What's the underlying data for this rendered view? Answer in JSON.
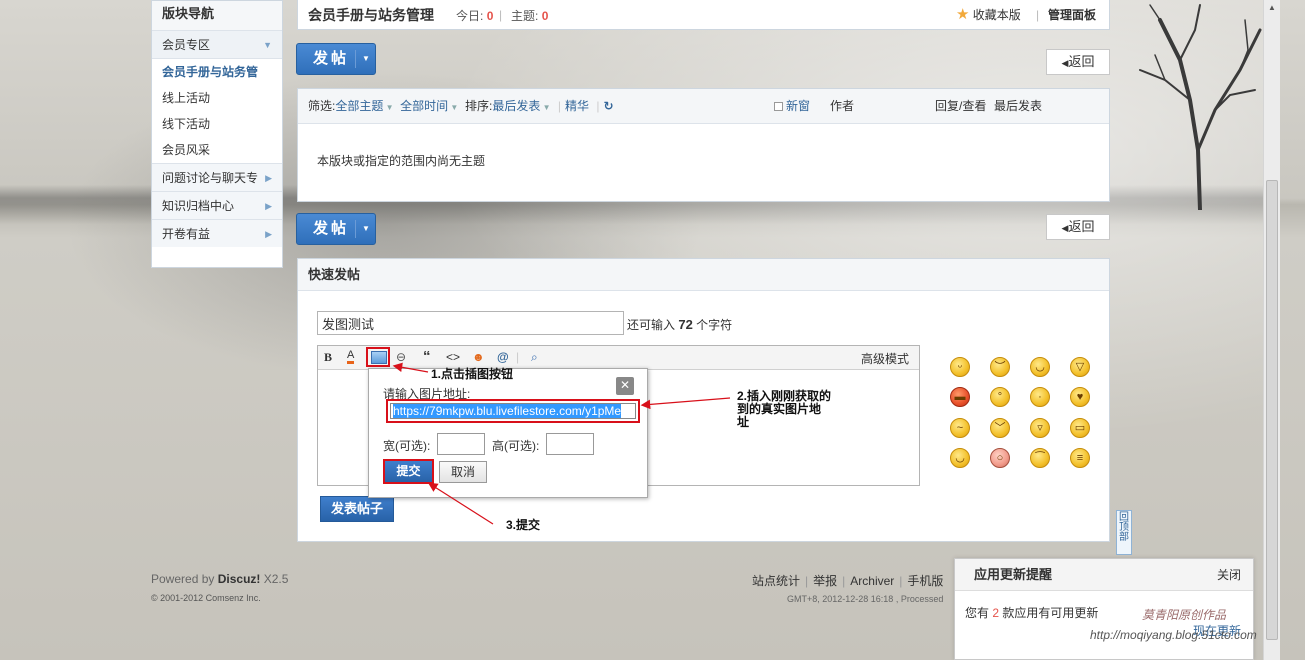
{
  "sidebar": {
    "title": "版块导航",
    "group1": "会员专区",
    "items": [
      "会员手册与站务管",
      "线上活动",
      "线下活动",
      "会员风采"
    ],
    "subgroups": [
      "问题讨论与聊天专",
      "知识归档中心",
      "开卷有益"
    ]
  },
  "header": {
    "forum_title": "会员手册与站务管理",
    "today_label": "今日:",
    "today_count": "0",
    "topics_label": "主题:",
    "topics_count": "0",
    "favorite_label": "收藏本版",
    "admin_label": "管理面板"
  },
  "actions": {
    "post_label": "发帖",
    "back_label": "返回"
  },
  "thread_list": {
    "filter_label": "筛选:",
    "all_topics": "全部主题",
    "all_time": "全部时间",
    "sort_label": "排序:",
    "sort_value": "最后发表",
    "digest_label": "精华",
    "new_window_label": "新窗",
    "author_col": "作者",
    "reply_view_col": "回复/查看",
    "last_post_col": "最后发表",
    "empty_message": "本版块或指定的范围内尚无主题"
  },
  "quick_post": {
    "title": "快速发帖",
    "subject_value": "发图测试",
    "remaining_prefix": "还可输入",
    "remaining_count": "72",
    "remaining_suffix": "个字符",
    "advanced_mode": "高级模式",
    "submit_label": "发表帖子"
  },
  "image_dialog": {
    "prompt": "请输入图片地址:",
    "url_value": "https://79mkpw.blu.livefilestore.com/y1pMe",
    "width_label": "宽(可选):",
    "height_label": "高(可选):",
    "submit_label": "提交",
    "cancel_label": "取消"
  },
  "annotations": {
    "step1": "1.点击插图按钮",
    "step2_line1": "2.插入刚刚获取的",
    "step2_line2": "到的真实图片地",
    "step2_line3": "址",
    "step3": "3.提交"
  },
  "footer": {
    "powered_by": "Powered by",
    "brand": "Discuz!",
    "version": "X2.5",
    "copyright": "© 2001-2012 Comsenz Inc.",
    "links": [
      "站点统计",
      "举报",
      "Archiver",
      "手机版"
    ],
    "gmt": "GMT+8, 2012-12-28 16:18 , Processed"
  },
  "back_to_top": "回顶部",
  "notice": {
    "title": "应用更新提醒",
    "close_label": "关闭",
    "message_prefix": "您有",
    "count": "2",
    "message_suffix": "款应用有可用更新",
    "update_label": "现在更新"
  },
  "watermark": {
    "text_cn": "莫青阳原创作品",
    "url": "http://moqiyang.blog.51cto.com"
  },
  "colors": {
    "accent_blue": "#2f6fba",
    "link_blue": "#336699",
    "count_red": "#e5534b",
    "highlight_red": "#d8101a"
  }
}
